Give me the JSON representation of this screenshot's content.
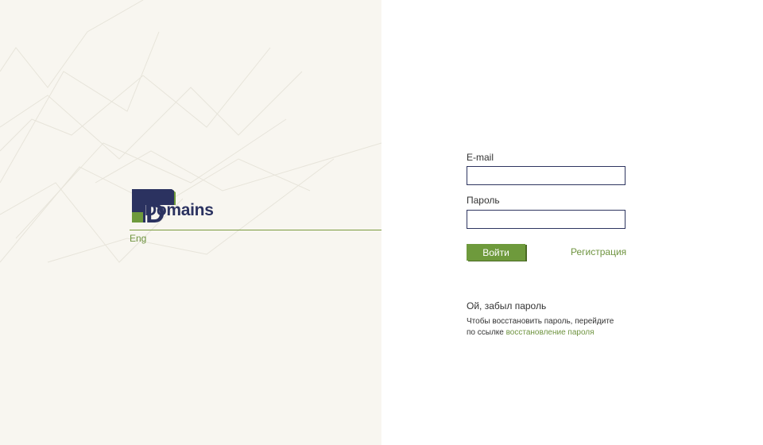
{
  "brand": {
    "logo_text": "Domains",
    "colors": {
      "navy": "#2b3260",
      "green": "#6e9a3c",
      "panel_bg": "#f8f6f0"
    }
  },
  "left": {
    "lang_link": "Eng"
  },
  "form": {
    "email_label": "E-mail",
    "email_value": "",
    "password_label": "Пароль",
    "password_value": "",
    "login_button": "Войти",
    "register_link": "Регистрация"
  },
  "recovery": {
    "title": "Ой, забыл пароль",
    "text_line1": "Чтобы восстановить пароль, перейдите",
    "text_line2": "по ссылке",
    "link": "восстановление пароля"
  }
}
